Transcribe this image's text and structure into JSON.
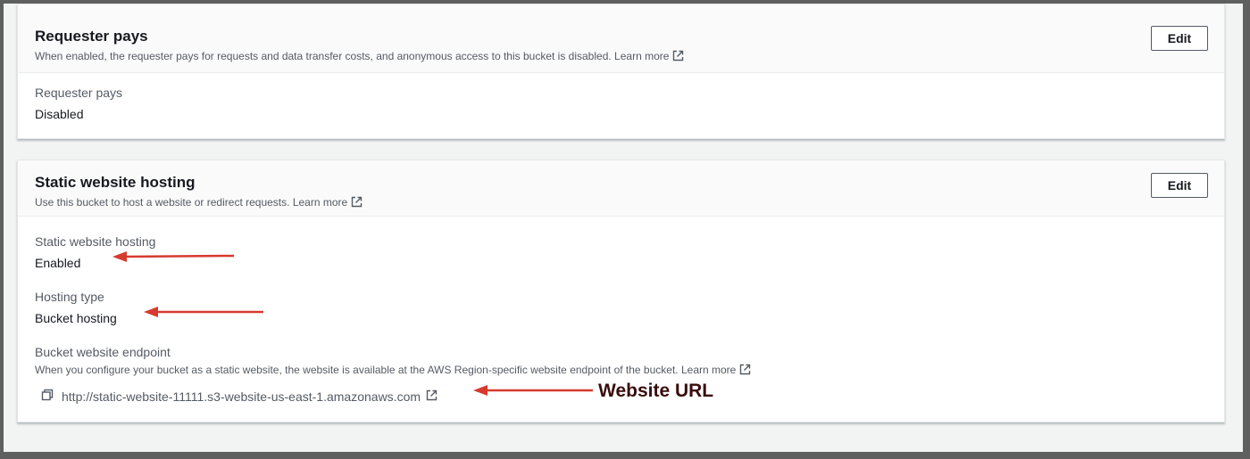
{
  "requester_pays": {
    "title": "Requester pays",
    "description": "When enabled, the requester pays for requests and data transfer costs, and anonymous access to this bucket is disabled.",
    "learn_more": "Learn more",
    "edit_label": "Edit",
    "field_label": "Requester pays",
    "field_value": "Disabled"
  },
  "static_hosting": {
    "title": "Static website hosting",
    "description": "Use this bucket to host a website or redirect requests.",
    "learn_more": "Learn more",
    "edit_label": "Edit",
    "hosting_label": "Static website hosting",
    "hosting_value": "Enabled",
    "type_label": "Hosting type",
    "type_value": "Bucket hosting",
    "endpoint_label": "Bucket website endpoint",
    "endpoint_desc": "When you configure your bucket as a static website, the website is available at the AWS Region-specific website endpoint of the bucket.",
    "endpoint_learn_more": "Learn more",
    "endpoint_url": "http://static-website-11111.s3-website-us-east-1.amazonaws.com"
  },
  "annotations": {
    "website_url_label": "Website URL",
    "arrow_color": "#d63a2f"
  },
  "icons": {
    "external": "external-link-icon",
    "copy": "copy-icon"
  }
}
